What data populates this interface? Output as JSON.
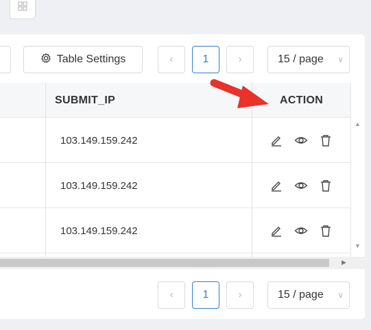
{
  "toolbar": {
    "table_settings_label": "Table Settings",
    "pagination": {
      "current_page": "1",
      "page_size": "15 / page"
    }
  },
  "table": {
    "columns": [
      "SUBMIT_IP",
      "ACTION"
    ],
    "rows": [
      {
        "submit_ip": "103.149.159.242"
      },
      {
        "submit_ip": "103.149.159.242"
      },
      {
        "submit_ip": "103.149.159.242"
      }
    ]
  },
  "footer": {
    "pagination": {
      "current_page": "1",
      "page_size": "15 / page"
    }
  },
  "annotation": {
    "arrow_color": "#e8322a",
    "points_to": "ACTION"
  },
  "colors": {
    "accent": "#2f7ec9",
    "header_bg": "#f6f7f8"
  }
}
